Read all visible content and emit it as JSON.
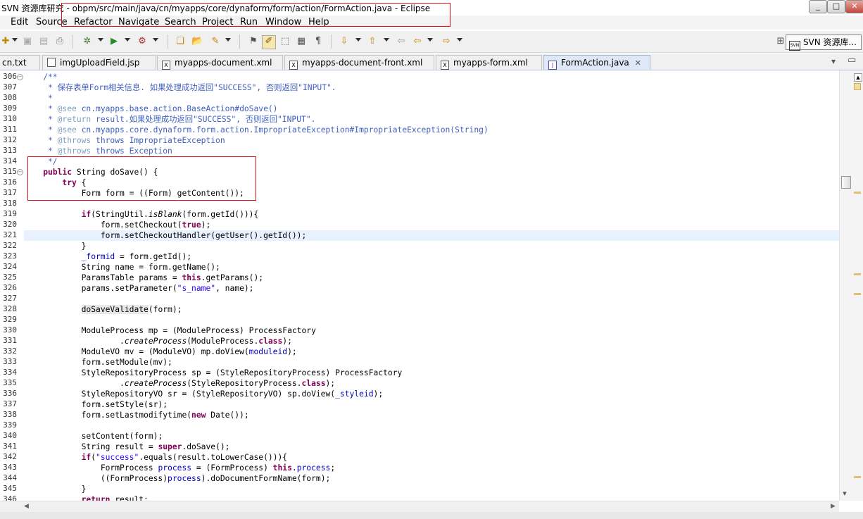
{
  "window": {
    "app_title": "SVN 资源库研究",
    "path_title": " - obpm/src/main/java/cn/myapps/core/dynaform/form/action/FormAction.java - Eclipse",
    "btn_min": "_",
    "btn_max": "□",
    "btn_close": "✕"
  },
  "menu": [
    "Edit",
    "Source",
    "Refactor",
    "Navigate",
    "Search",
    "Project",
    "Run",
    "Window",
    "Help"
  ],
  "perspective": {
    "label": "SVN 资源库..."
  },
  "tabs": [
    {
      "label": "cn.txt"
    },
    {
      "label": "imgUploadField.jsp"
    },
    {
      "label": "myapps-document.xml"
    },
    {
      "label": "myapps-document-front.xml"
    },
    {
      "label": "myapps-form.xml"
    },
    {
      "label": "FormAction.java",
      "close": "✕"
    }
  ],
  "view_menu": "▾",
  "maximize": "▭",
  "code_lines": [
    {
      "n": "306",
      "t": "    /**"
    },
    {
      "n": "307",
      "t": "     * 保存表单Form相关信息. 如果处理成功返回\"SUCCESS\", 否则返回\"INPUT\"."
    },
    {
      "n": "308",
      "t": "     *"
    },
    {
      "n": "309",
      "t": "     * @see cn.myapps.base.action.BaseAction#doSave()"
    },
    {
      "n": "310",
      "t": "     * @return result.如果处理成功返回\"SUCCESS\", 否则返回\"INPUT\"."
    },
    {
      "n": "311",
      "t": "     * @see cn.myapps.core.dynaform.form.action.ImpropriateException#ImpropriateException(String)"
    },
    {
      "n": "312",
      "t": "     * @throws throws ImpropriateException"
    },
    {
      "n": "313",
      "t": "     * @throws throws Exception"
    },
    {
      "n": "314",
      "t": "     */"
    },
    {
      "n": "315",
      "t": "    public String doSave() {"
    },
    {
      "n": "316",
      "t": "        try {"
    },
    {
      "n": "317",
      "t": "            Form form = ((Form) getContent());"
    },
    {
      "n": "318",
      "t": ""
    },
    {
      "n": "319",
      "t": "            if(StringUtil.isBlank(form.getId())){"
    },
    {
      "n": "320",
      "t": "                form.setCheckout(true);"
    },
    {
      "n": "321",
      "t": "                form.setCheckoutHandler(getUser().getId());"
    },
    {
      "n": "322",
      "t": "            }"
    },
    {
      "n": "323",
      "t": "            _formid = form.getId();"
    },
    {
      "n": "324",
      "t": "            String name = form.getName();"
    },
    {
      "n": "325",
      "t": "            ParamsTable params = this.getParams();"
    },
    {
      "n": "326",
      "t": "            params.setParameter(\"s_name\", name);"
    },
    {
      "n": "327",
      "t": ""
    },
    {
      "n": "328",
      "t": "            doSaveValidate(form);"
    },
    {
      "n": "329",
      "t": ""
    },
    {
      "n": "330",
      "t": "            ModuleProcess mp = (ModuleProcess) ProcessFactory"
    },
    {
      "n": "331",
      "t": "                    .createProcess(ModuleProcess.class);"
    },
    {
      "n": "332",
      "t": "            ModuleVO mv = (ModuleVO) mp.doView(moduleid);"
    },
    {
      "n": "333",
      "t": "            form.setModule(mv);"
    },
    {
      "n": "334",
      "t": "            StyleRepositoryProcess sp = (StyleRepositoryProcess) ProcessFactory"
    },
    {
      "n": "335",
      "t": "                    .createProcess(StyleRepositoryProcess.class);"
    },
    {
      "n": "336",
      "t": "            StyleRepositoryVO sr = (StyleRepositoryVO) sp.doView(_styleid);"
    },
    {
      "n": "337",
      "t": "            form.setStyle(sr);"
    },
    {
      "n": "338",
      "t": "            form.setLastmodifytime(new Date());"
    },
    {
      "n": "339",
      "t": ""
    },
    {
      "n": "340",
      "t": "            setContent(form);"
    },
    {
      "n": "341",
      "t": "            String result = super.doSave();"
    },
    {
      "n": "342",
      "t": "            if(\"success\".equals(result.toLowerCase())){"
    },
    {
      "n": "343",
      "t": "                FormProcess process = (FormProcess) this.process;"
    },
    {
      "n": "344",
      "t": "                ((FormProcess)process).doDocumentFormName(form);"
    },
    {
      "n": "345",
      "t": "            }"
    },
    {
      "n": "346",
      "t": "            return result;"
    }
  ],
  "colors": {
    "keyword": "#7f0055",
    "comment": "#3f5fbf",
    "javadoc_tag": "#7f9fbf",
    "string": "#2a00ff",
    "field": "#0000c0",
    "current_line": "#e8f2fe",
    "annotation_box": "#e0101a"
  }
}
